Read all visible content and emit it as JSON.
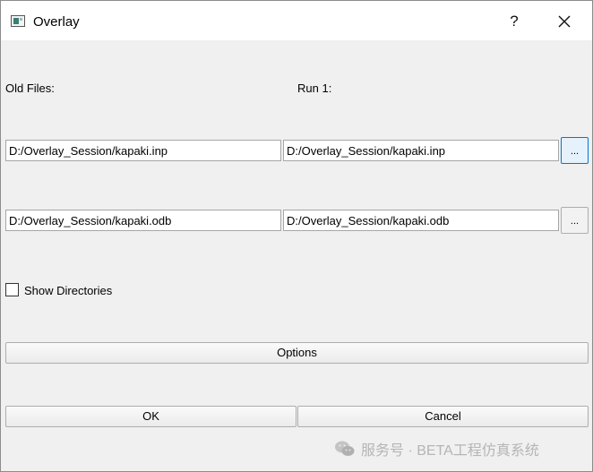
{
  "window": {
    "title": "Overlay",
    "help_label": "?",
    "icons": {
      "app": "window-icon",
      "close": "close-icon"
    }
  },
  "form": {
    "old_files_label": "Old Files:",
    "run_label": "Run 1:",
    "rows": [
      {
        "old_value": "D:/Overlay_Session/kapaki.inp",
        "run_value": "D:/Overlay_Session/kapaki.inp",
        "browse_label": "..."
      },
      {
        "old_value": "D:/Overlay_Session/kapaki.odb",
        "run_value": "D:/Overlay_Session/kapaki.odb",
        "browse_label": "..."
      }
    ],
    "show_directories_label": "Show Directories",
    "show_directories_checked": false,
    "options_label": "Options",
    "ok_label": "OK",
    "cancel_label": "Cancel"
  },
  "watermark": {
    "text": "服务号 · BETA工程仿真系统",
    "icon": "wechat-icon"
  }
}
